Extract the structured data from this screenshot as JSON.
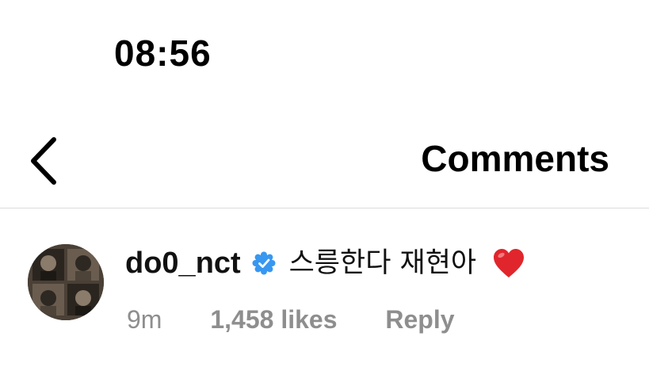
{
  "status_bar": {
    "time": "08:56"
  },
  "header": {
    "title": "Comments",
    "back_icon": "chevron-left-icon"
  },
  "comment": {
    "username": "do0_nct",
    "verified": true,
    "text": "스릉한다 재현아",
    "emoji": "heart-emoji",
    "time_ago": "9m",
    "likes": "1,458 likes",
    "reply_label": "Reply"
  },
  "colors": {
    "verified_blue": "#3897f0",
    "meta_gray": "#8e8e8e",
    "heart_red": "#e0262c"
  }
}
